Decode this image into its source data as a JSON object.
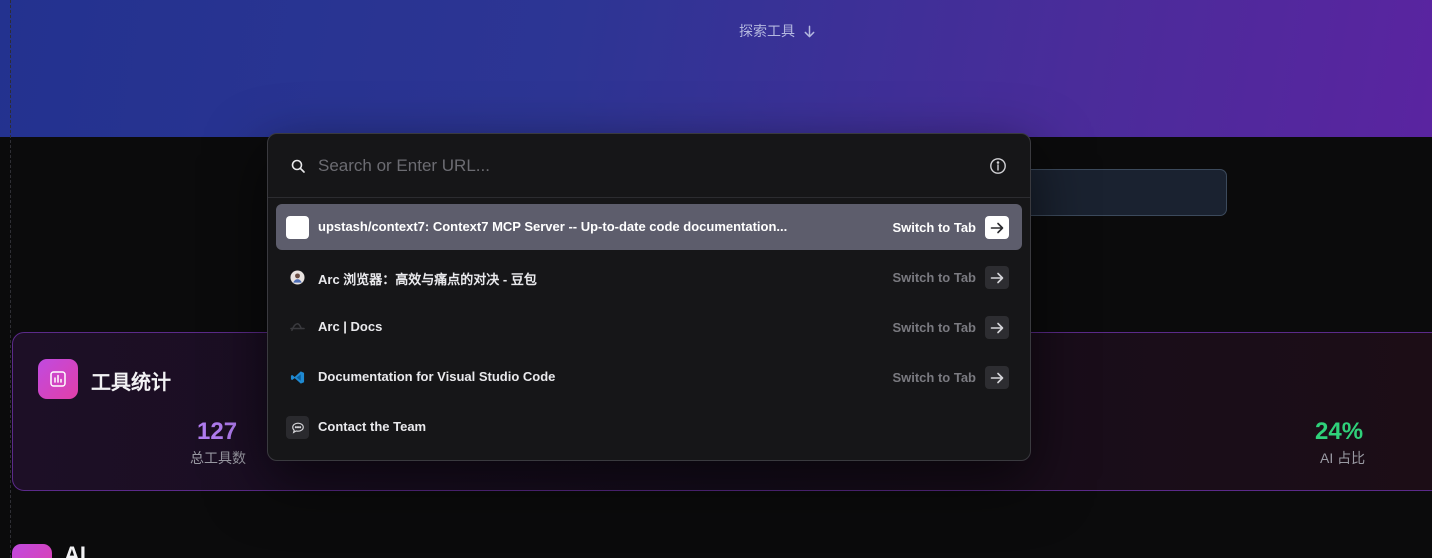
{
  "hero": {
    "explore_label": "探索工具"
  },
  "stats": {
    "title": "工具统计",
    "total_value": "127",
    "total_label": "总工具数",
    "ai_value": "24%",
    "ai_label": "AI 占比",
    "total_color": "#b07cf0",
    "ai_color": "#2fd07a"
  },
  "ai_section": {
    "title": "AI"
  },
  "palette": {
    "search_placeholder": "Search or Enter URL...",
    "search_value": "",
    "results": [
      {
        "title": "upstash/context7: Context7 MCP Server -- Up-to-date code documentation...",
        "action": "Switch to Tab",
        "icon": "page-icon",
        "selected": true
      },
      {
        "title": "Arc 浏览器：高效与痛点的对决 - 豆包",
        "action": "Switch to Tab",
        "icon": "doubao-avatar-icon",
        "selected": false
      },
      {
        "title": "Arc | Docs",
        "action": "Switch to Tab",
        "icon": "arc-logo-icon",
        "selected": false
      },
      {
        "title": "Documentation for Visual Studio Code",
        "action": "Switch to Tab",
        "icon": "vscode-icon",
        "selected": false
      },
      {
        "title": "Contact the Team",
        "action": "",
        "icon": "chat-bubble-icon",
        "selected": false
      }
    ]
  }
}
